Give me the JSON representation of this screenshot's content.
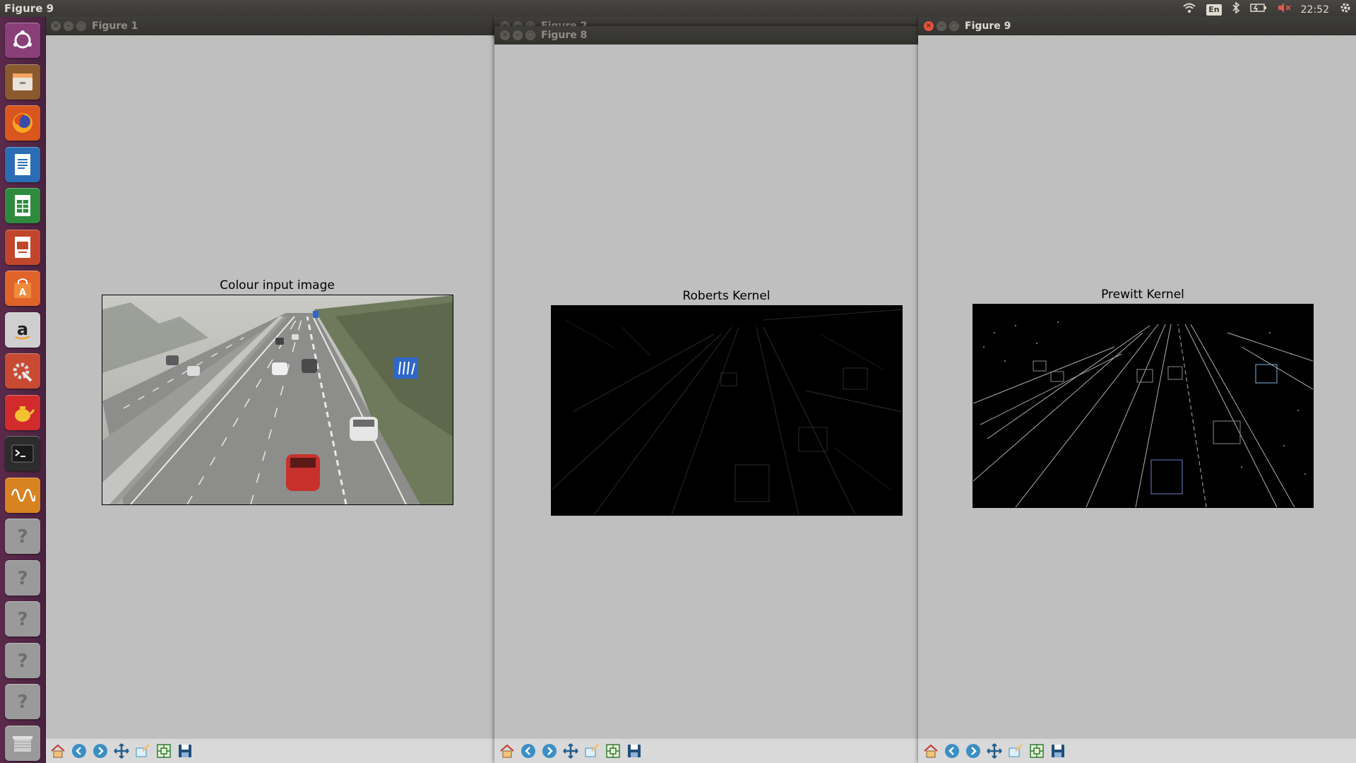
{
  "top_panel": {
    "title": "Figure 9",
    "keyboard_layout": "En",
    "clock": "22:52"
  },
  "launcher": {
    "items": [
      {
        "name": "ubuntu-dash-icon",
        "color": "#8a3f79"
      },
      {
        "name": "file-manager-icon",
        "color": "#8a5a2e"
      },
      {
        "name": "firefox-icon",
        "color": "#d9561e"
      },
      {
        "name": "libreoffice-writer-icon",
        "color": "#2a6db5"
      },
      {
        "name": "libreoffice-calc-icon",
        "color": "#2e8b3d"
      },
      {
        "name": "libreoffice-impress-icon",
        "color": "#c2462b"
      },
      {
        "name": "software-center-icon",
        "color": "#e0632a"
      },
      {
        "name": "amazon-icon",
        "color": "#cfcfcf"
      },
      {
        "name": "system-settings-icon",
        "color": "#c94a33"
      },
      {
        "name": "teapot-app-icon",
        "color": "#d12b2b"
      },
      {
        "name": "terminal-icon",
        "color": "#2c2c2c"
      },
      {
        "name": "oscilloscope-app-icon",
        "color": "#d98220"
      },
      {
        "name": "unknown-app-icon",
        "color": "#9a9a9a"
      },
      {
        "name": "unknown-app-icon",
        "color": "#9a9a9a"
      },
      {
        "name": "unknown-app-icon",
        "color": "#9a9a9a"
      },
      {
        "name": "unknown-app-icon",
        "color": "#9a9a9a"
      },
      {
        "name": "unknown-app-icon",
        "color": "#9a9a9a"
      },
      {
        "name": "trash-icon",
        "color": "#9a9a9a"
      }
    ]
  },
  "windows": {
    "figure1": {
      "title": "Figure 1",
      "axes_title": "Colour input image"
    },
    "figure2": {
      "title": "Figure 2"
    },
    "figure8": {
      "title": "Figure 8",
      "axes_title": "Roberts Kernel"
    },
    "figure9": {
      "title": "Figure 9",
      "axes_title": "Prewitt Kernel"
    }
  },
  "toolbar_icons": [
    "home-icon",
    "back-icon",
    "forward-icon",
    "pan-icon",
    "zoom-icon",
    "configure-subplots-icon",
    "save-icon"
  ],
  "colors": {
    "figure_bg": "#bfbfbf",
    "close_active": "#e0553c",
    "launcher_bg": "#5b2a4b"
  }
}
